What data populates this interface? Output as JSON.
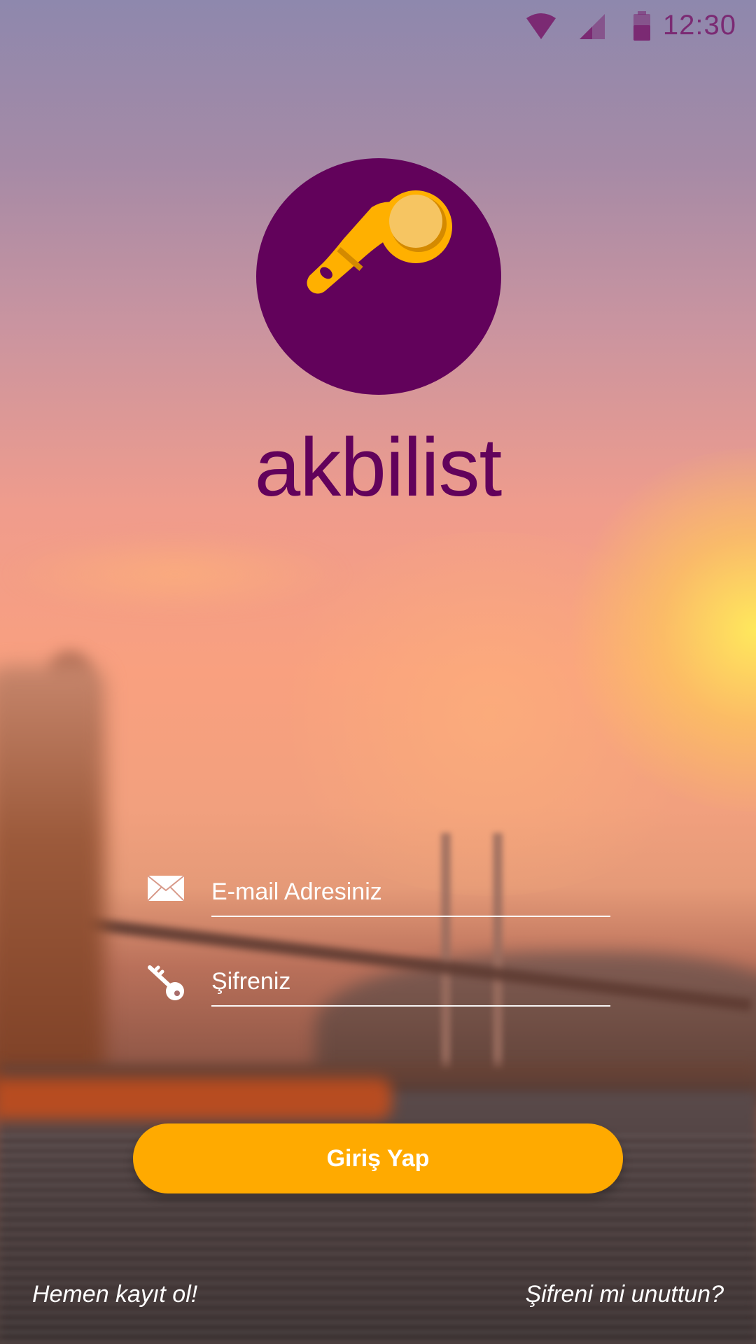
{
  "status_bar": {
    "time": "12:30",
    "icons": [
      "wifi-icon",
      "cellular-signal-icon",
      "battery-icon"
    ],
    "color": "#7b2a73"
  },
  "logo": {
    "brand_name": "akbilist",
    "icon": "key-fob-icon",
    "circle_color": "#62025b",
    "key_color": "#ffb000"
  },
  "form": {
    "email": {
      "placeholder": "E-mail Adresiniz",
      "value": "",
      "icon": "envelope-icon"
    },
    "password": {
      "placeholder": "Şifreniz",
      "value": "",
      "icon": "key-icon"
    }
  },
  "actions": {
    "login_label": "Giriş Yap",
    "login_color": "#ffaa00",
    "register_link": "Hemen kayıt ol!",
    "forgot_link": "Şifreni mi unuttun?"
  }
}
